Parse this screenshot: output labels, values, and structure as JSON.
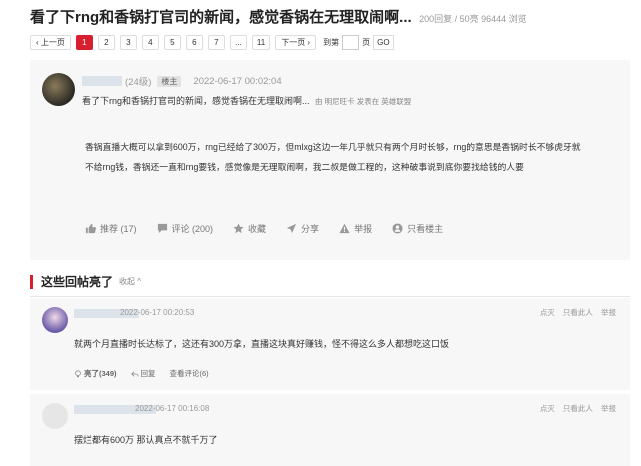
{
  "thread": {
    "title": "看了下rng和香锅打官司的新闻，感觉香锅在无理取闹啊...",
    "meta": "200回复 / 50亮 96444 浏览"
  },
  "pager": {
    "prev": "‹ 上一页",
    "pages": [
      "1",
      "2",
      "3",
      "4",
      "5",
      "6",
      "7",
      "...",
      "11"
    ],
    "active_page": "1",
    "next": "下一页 ›",
    "jump_label": "到第",
    "jump_unit": "页",
    "go": "GO"
  },
  "post": {
    "level": "(24级)",
    "badge": "楼主",
    "time": "2022-06-17 00:02:04",
    "subject": "看了下rng和香锅打官司的新闻，感觉香锅在无理取闹啊...",
    "from": "由 明尼旺卡 发表在 英雄联盟",
    "body": "香锅直播大概可以拿到600万，rng已经给了300万，但mlxg这边一年几乎就只有两个月时长够，rng的意思是香锅时长不够虎牙就不给rng钱，香锅还一直和rng要钱，感觉像是无理取闹啊，我二叔是做工程的，这种破事说到底你要找给钱的人要",
    "actions": {
      "recommend": "推荐 (17)",
      "comment": "评论 (200)",
      "favorite": "收藏",
      "share": "分享",
      "report": "举报",
      "only_op": "只看楼主"
    }
  },
  "section": {
    "title": "这些回帖亮了",
    "collapse": "收起 ^"
  },
  "replies": [
    {
      "time": "2022-06-17 00:20:53",
      "tools": [
        "点灭",
        "只看此人",
        "举报"
      ],
      "content": "就两个月直播时长达标了，这还有300万拿，直播这块真好赚钱，怪不得这么多人都想吃这口饭",
      "likes": "亮了(349)",
      "reply": "回复",
      "view_comments": "查看评论(6)"
    },
    {
      "time": "2022-06-17 00:16:08",
      "tools": [
        "点灭",
        "只看此人",
        "举报"
      ],
      "content": "摆烂都有600万 那认真点不就千万了"
    }
  ],
  "colors": {
    "accent": "#d71f30",
    "card_bg": "#f7f7f7"
  }
}
